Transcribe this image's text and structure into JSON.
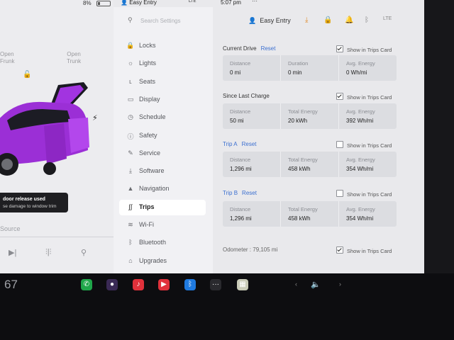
{
  "status": {
    "battery_percent": "8%",
    "profile": "Easy Entry",
    "signal": "LTE",
    "clock": "5:07 pm"
  },
  "car_panel": {
    "open_frunk_label": "Open\nFrunk",
    "open_trunk_label": "Open\nTrunk",
    "alert_title": "door release used",
    "alert_body": "se damage to window trim",
    "source_label": "Source",
    "car_color": "#9b2fd6"
  },
  "search": {
    "placeholder": "Search Settings"
  },
  "nav": [
    {
      "label": "Locks",
      "icon": "lock-icon",
      "glyph": "🔒"
    },
    {
      "label": "Lights",
      "icon": "lights-icon",
      "glyph": "☼"
    },
    {
      "label": "Seats",
      "icon": "seat-icon",
      "glyph": "ʟ"
    },
    {
      "label": "Display",
      "icon": "display-icon",
      "glyph": "▭"
    },
    {
      "label": "Schedule",
      "icon": "schedule-icon",
      "glyph": "◷"
    },
    {
      "label": "Safety",
      "icon": "safety-icon",
      "glyph": "ⓘ"
    },
    {
      "label": "Service",
      "icon": "wrench-icon",
      "glyph": "✎"
    },
    {
      "label": "Software",
      "icon": "download-icon",
      "glyph": "⤓"
    },
    {
      "label": "Navigation",
      "icon": "navigation-icon",
      "glyph": "▲"
    },
    {
      "label": "Trips",
      "icon": "trips-icon",
      "glyph": "∫∫"
    },
    {
      "label": "Wi-Fi",
      "icon": "wifi-icon",
      "glyph": "≋"
    },
    {
      "label": "Bluetooth",
      "icon": "bluetooth-icon",
      "glyph": "ᛒ"
    },
    {
      "label": "Upgrades",
      "icon": "upgrades-icon",
      "glyph": "⌂"
    }
  ],
  "active_nav": "Trips",
  "header": {
    "profile": "Easy Entry"
  },
  "current_drive": {
    "title": "Current Drive",
    "reset": "Reset",
    "show_in_trips_card": "Show in Trips Card",
    "checked": true,
    "stats": [
      {
        "label": "Distance",
        "value": "0 mi"
      },
      {
        "label": "Duration",
        "value": "0 min"
      },
      {
        "label": "Avg. Energy",
        "value": "0 Wh/mi"
      }
    ]
  },
  "since_last_charge": {
    "title": "Since Last Charge",
    "show_in_trips_card": "Show in Trips Card",
    "checked": true,
    "stats": [
      {
        "label": "Distance",
        "value": "50 mi"
      },
      {
        "label": "Total Energy",
        "value": "20 kWh"
      },
      {
        "label": "Avg. Energy",
        "value": "392 Wh/mi"
      }
    ]
  },
  "trip_a": {
    "title": "Trip A",
    "reset": "Reset",
    "show_in_trips_card": "Show in Trips Card",
    "checked": false,
    "stats": [
      {
        "label": "Distance",
        "value": "1,296 mi"
      },
      {
        "label": "Total Energy",
        "value": "458 kWh"
      },
      {
        "label": "Avg. Energy",
        "value": "354 Wh/mi"
      }
    ]
  },
  "trip_b": {
    "title": "Trip B",
    "reset": "Reset",
    "show_in_trips_card": "Show in Trips Card",
    "checked": false,
    "stats": [
      {
        "label": "Distance",
        "value": "1,296 mi"
      },
      {
        "label": "Total Energy",
        "value": "458 kWh"
      },
      {
        "label": "Avg. Energy",
        "value": "354 Wh/mi"
      }
    ]
  },
  "odometer": {
    "text": "Odometer : 79,105 mi",
    "show_in_trips_card": "Show in Trips Card",
    "checked": true
  },
  "taskbar": {
    "temperature": "67",
    "apps": [
      {
        "icon": "phone-icon",
        "color": "#1fa64a",
        "glyph": "✆"
      },
      {
        "icon": "camera-icon",
        "color": "#3a2a55",
        "glyph": "●"
      },
      {
        "icon": "music-icon",
        "color": "#e0313b",
        "glyph": "♪"
      },
      {
        "icon": "media-play-icon",
        "color": "#e0313b",
        "glyph": "▶"
      },
      {
        "icon": "bluetooth-app-icon",
        "color": "#1f7ae0",
        "glyph": "ᛒ"
      },
      {
        "icon": "more-icon",
        "color": "#2a2a2e",
        "glyph": "···"
      },
      {
        "icon": "calendar-icon",
        "color": "#c9cbb8",
        "glyph": "▦"
      }
    ]
  },
  "colors": {
    "accent": "#3b6fd0",
    "alert_bg": "#1f1f22"
  }
}
